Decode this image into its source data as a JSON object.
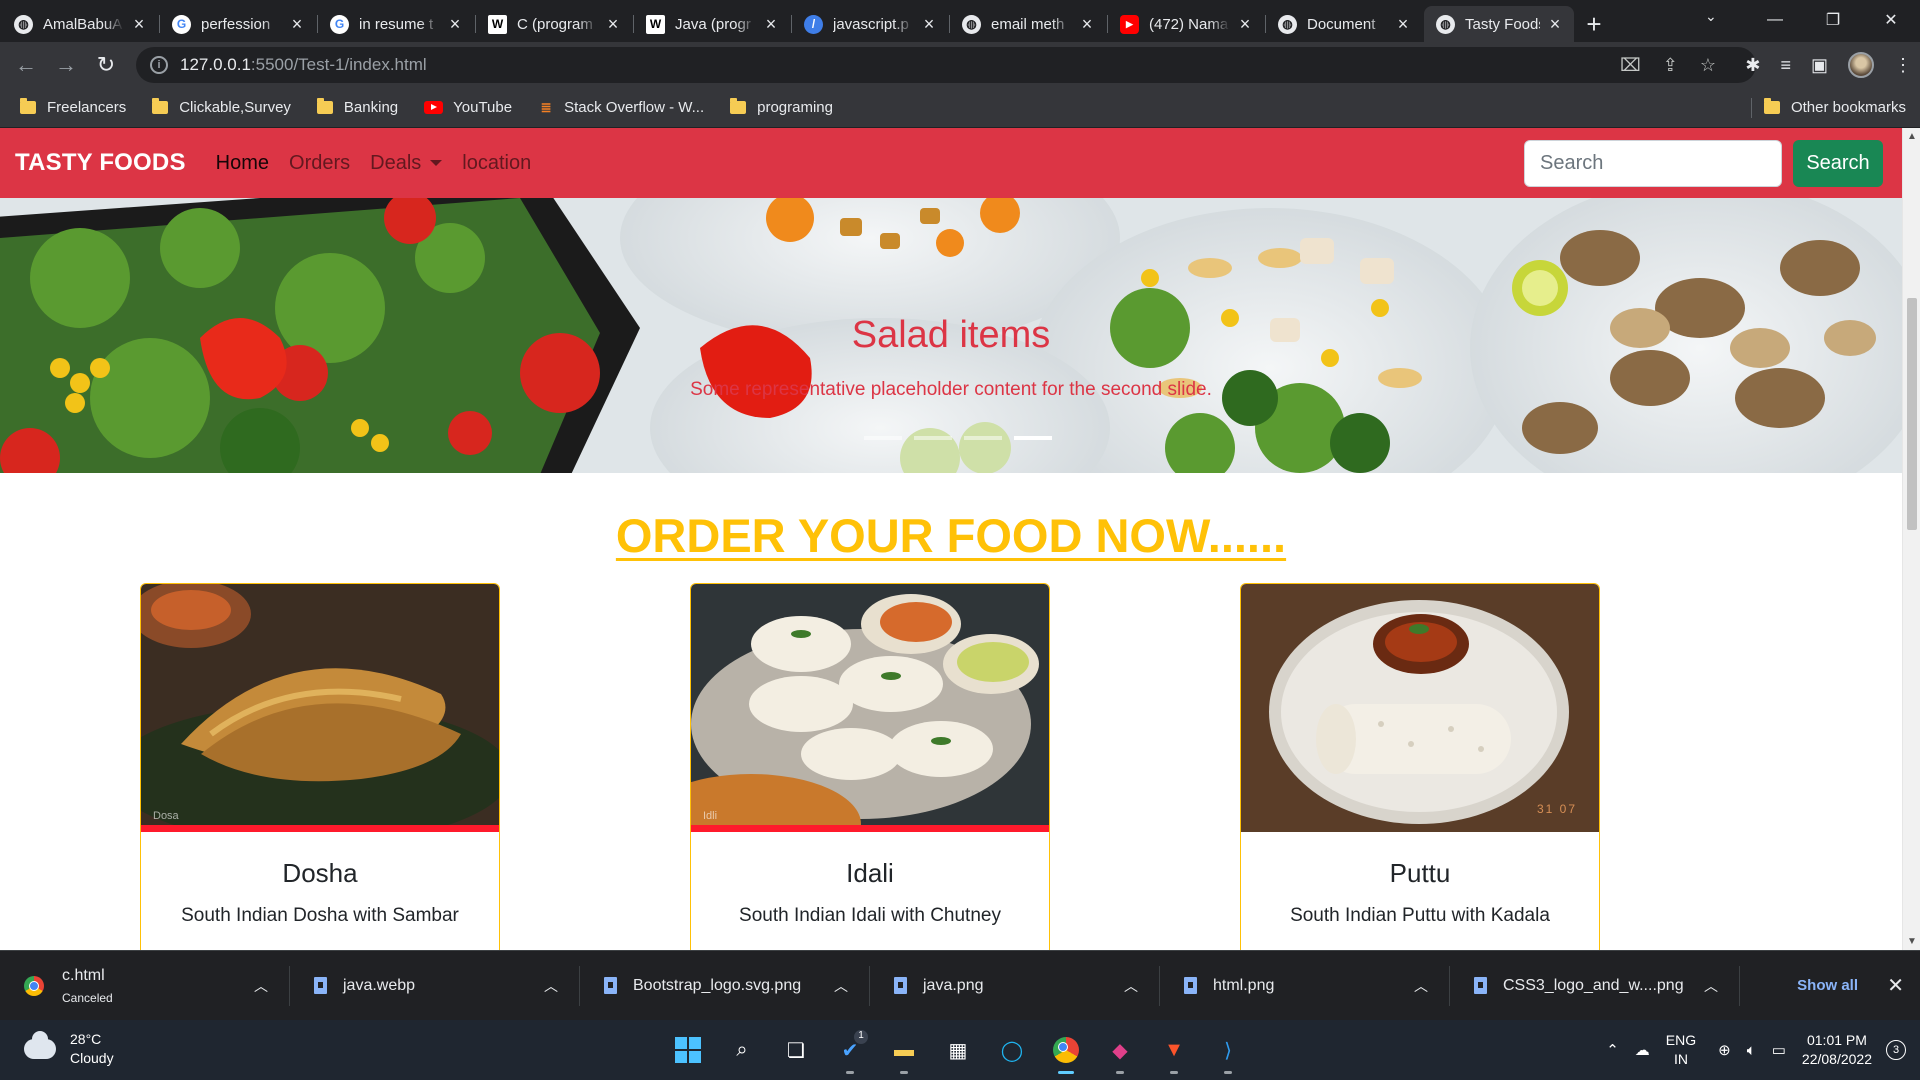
{
  "browser": {
    "tabs": [
      {
        "title": "AmalBabuA",
        "favicon": "globe-icon"
      },
      {
        "title": "perfession",
        "favicon": "google-icon"
      },
      {
        "title": "in resume t",
        "favicon": "google-icon"
      },
      {
        "title": "C (program",
        "favicon": "wikipedia-icon"
      },
      {
        "title": "Java (progr",
        "favicon": "wikipedia-icon"
      },
      {
        "title": "javascript.p",
        "favicon": "js-site-icon"
      },
      {
        "title": "email meth",
        "favicon": "globe-icon"
      },
      {
        "title": "(472) Nama",
        "favicon": "youtube-icon"
      },
      {
        "title": "Document",
        "favicon": "globe-icon"
      },
      {
        "title": "Tasty Foods",
        "favicon": "globe-icon",
        "active": true
      }
    ],
    "url_host": "127.0.0.1",
    "url_path": ":5500/Test-1/index.html",
    "bookmarks": [
      {
        "label": "Freelancers",
        "icon": "folder-icon"
      },
      {
        "label": "Clickable,Survey",
        "icon": "folder-icon"
      },
      {
        "label": "Banking",
        "icon": "folder-icon"
      },
      {
        "label": "YouTube",
        "icon": "youtube-icon"
      },
      {
        "label": "Stack Overflow - W...",
        "icon": "stackoverflow-icon"
      },
      {
        "label": "programing",
        "icon": "folder-icon"
      }
    ],
    "other_bookmarks": "Other bookmarks"
  },
  "site": {
    "brand": "TASTY FOODS",
    "nav": {
      "home": "Home",
      "orders": "Orders",
      "deals": "Deals",
      "location": "location"
    },
    "search_placeholder": "Search",
    "search_button": "Search",
    "brand_color": "#dc3545",
    "accent_color": "#ffc107",
    "carousel": {
      "title": "Salad items",
      "text": "Some representative placeholder content for the second slide.",
      "slides": 4,
      "active_slide": 4
    },
    "heading": "ORDER YOUR FOOD NOW......",
    "cards": [
      {
        "title": "Dosha",
        "text": "South Indian Dosha with Sambar",
        "image_caption": "Dosa"
      },
      {
        "title": "Idali",
        "text": "South Indian Idali with Chutney",
        "image_caption": "Idli"
      },
      {
        "title": "Puttu",
        "text": "South Indian Puttu with Kadala",
        "image_caption": "31  07"
      }
    ]
  },
  "downloads": {
    "items": [
      {
        "name": "c.html",
        "status": "Canceled"
      },
      {
        "name": "java.webp"
      },
      {
        "name": "Bootstrap_logo.svg.png"
      },
      {
        "name": "java.png"
      },
      {
        "name": "html.png"
      },
      {
        "name": "CSS3_logo_and_w....png"
      }
    ],
    "show_all": "Show all"
  },
  "taskbar": {
    "temp": "28°C",
    "weather": "Cloudy",
    "lang_top": "ENG",
    "lang_bottom": "IN",
    "time": "01:01 PM",
    "date": "22/08/2022",
    "notifications": "3",
    "vscode_badge": "1"
  }
}
